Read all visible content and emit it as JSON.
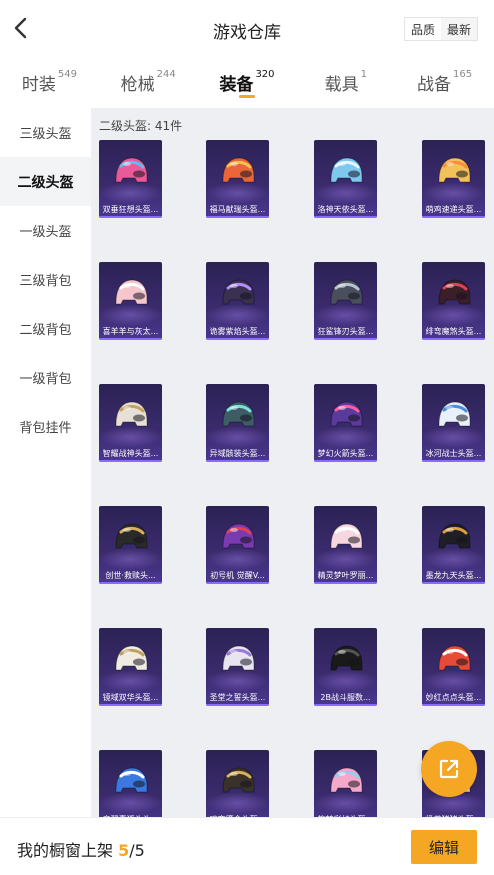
{
  "header": {
    "title": "游戏仓库",
    "toggle": [
      {
        "label": "品质",
        "active": true
      },
      {
        "label": "最新",
        "active": false
      }
    ]
  },
  "tabs": [
    {
      "label": "时装",
      "count": "549",
      "active": false
    },
    {
      "label": "枪械",
      "count": "244",
      "active": false
    },
    {
      "label": "装备",
      "count": "320",
      "active": true
    },
    {
      "label": "载具",
      "count": "1",
      "active": false
    },
    {
      "label": "战备",
      "count": "165",
      "active": false
    }
  ],
  "sidebar": {
    "items": [
      {
        "label": "三级头盔",
        "active": false
      },
      {
        "label": "二级头盔",
        "active": true
      },
      {
        "label": "一级头盔",
        "active": false
      },
      {
        "label": "三级背包",
        "active": false
      },
      {
        "label": "二级背包",
        "active": false
      },
      {
        "label": "一级背包",
        "active": false
      },
      {
        "label": "背包挂件",
        "active": false
      }
    ]
  },
  "content": {
    "section_label": "二级头盔: 41件",
    "items": [
      {
        "name": "双垂狂想头盔...",
        "color": "#e85a9a",
        "accent": "#5bc0f0"
      },
      {
        "name": "福马献瑞头盔...",
        "color": "#e8663a",
        "accent": "#f2c14e"
      },
      {
        "name": "洛神天依头盔...",
        "color": "#7ec8f0",
        "accent": "#e8f4ff"
      },
      {
        "name": "萌鸡速递头盔...",
        "color": "#f2c25a",
        "accent": "#ff8a3d"
      },
      {
        "name": "喜羊羊与灰太...",
        "color": "#f6c6cf",
        "accent": "#ffffff"
      },
      {
        "name": "诡雾紫焰头盔...",
        "color": "#3a3050",
        "accent": "#b48cff"
      },
      {
        "name": "狂鲨锋刃头盔...",
        "color": "#4a4f5e",
        "accent": "#b8c2d0"
      },
      {
        "name": "绯弯魔煞头盔...",
        "color": "#3a1e28",
        "accent": "#e0405a"
      },
      {
        "name": "智耀战神头盔...",
        "color": "#e8e0d6",
        "accent": "#c8a060"
      },
      {
        "name": "异域骸装头盔...",
        "color": "#3e5c66",
        "accent": "#7fe0e0"
      },
      {
        "name": "梦幻火箭头盔...",
        "color": "#5a3a9a",
        "accent": "#ff5fa0"
      },
      {
        "name": "冰河战士头盔...",
        "color": "#e8f0fa",
        "accent": "#4a8ee0"
      },
      {
        "name": "创世·救赎头...",
        "color": "#2a2a2a",
        "accent": "#d8b060"
      },
      {
        "name": "初号机 觉醒V...",
        "color": "#7a3ab0",
        "accent": "#e0405a"
      },
      {
        "name": "精灵梦叶罗丽...",
        "color": "#f6d6e0",
        "accent": "#ffffff"
      },
      {
        "name": "墨龙九天头盔...",
        "color": "#1e1e24",
        "accent": "#d8a040"
      },
      {
        "name": "镜域双华头盔...",
        "color": "#f0ece4",
        "accent": "#c0a060"
      },
      {
        "name": "圣堂之誓头盔...",
        "color": "#e8e4f0",
        "accent": "#9a7ad8"
      },
      {
        "name": "2B战斗服数...",
        "color": "#1a1a1a",
        "accent": "#555555"
      },
      {
        "name": "妙红点点头盔...",
        "color": "#e84a3a",
        "accent": "#ffffff"
      },
      {
        "name": "音翼素狐头头...",
        "color": "#3a7ae0",
        "accent": "#ffffff"
      },
      {
        "name": "暗夜鎏金头盔...",
        "color": "#3a3228",
        "accent": "#d8b060"
      },
      {
        "name": "旋转彩虹头盔...",
        "color": "#f6a8c8",
        "accent": "#8ad0f0"
      },
      {
        "name": "奶茶猪猪头盔...",
        "color": "#f0d0b0",
        "accent": "#ffffff"
      }
    ]
  },
  "bottom_bar": {
    "shelf_label": "我的橱窗上架",
    "shelf_current": "5",
    "shelf_total": "/5",
    "edit_label": "编辑"
  },
  "colors": {
    "accent": "#f5a623",
    "card_bg": "#3b2b6e"
  },
  "icons": {
    "back": "chevron-left-icon",
    "share": "external-link-icon"
  }
}
